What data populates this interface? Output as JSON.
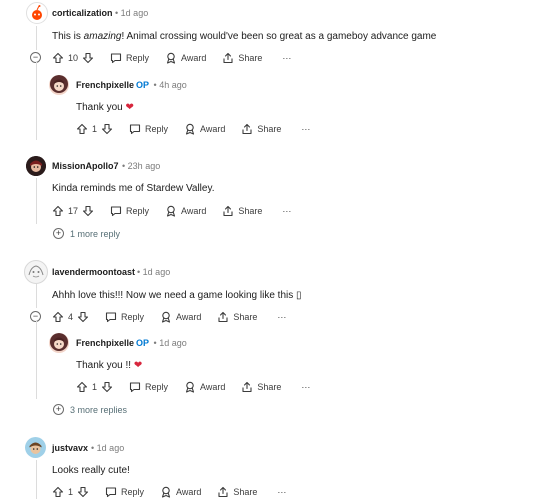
{
  "comments": [
    {
      "author": "corticalization",
      "age": "1d ago",
      "text_before": "This is ",
      "text_em": "amazing",
      "text_after": "! Animal crossing would've been so great as a gameboy advance game",
      "votes": "10",
      "reply_label": "Reply",
      "award_label": "Award",
      "share_label": "Share",
      "more_label": "···",
      "reply": {
        "author": "Frenchpixelle",
        "op_label": "OP",
        "age": "4h ago",
        "text": "Thank you",
        "votes": "1",
        "reply_label": "Reply",
        "award_label": "Award",
        "share_label": "Share",
        "more_label": "···"
      }
    },
    {
      "author": "MissionApollo7",
      "age": "23h ago",
      "text": "Kinda reminds me of Stardew Valley.",
      "votes": "17",
      "reply_label": "Reply",
      "award_label": "Award",
      "share_label": "Share",
      "more_label": "···",
      "more_replies": "1 more reply"
    },
    {
      "author": "lavendermoontoast",
      "age": "1d ago",
      "text": "Ahhh love this!!! Now we need a game looking like this ▯",
      "votes": "4",
      "reply_label": "Reply",
      "award_label": "Award",
      "share_label": "Share",
      "more_label": "···",
      "reply": {
        "author": "Frenchpixelle",
        "op_label": "OP",
        "age": "1d ago",
        "text": "Thank you !!",
        "votes": "1",
        "reply_label": "Reply",
        "award_label": "Award",
        "share_label": "Share",
        "more_label": "···"
      },
      "more_replies": "3 more replies"
    },
    {
      "author": "justvavx",
      "age": "1d ago",
      "text": "Looks really cute!",
      "votes": "1",
      "reply_label": "Reply",
      "award_label": "Award",
      "share_label": "Share",
      "more_label": "···"
    }
  ],
  "separator": "•",
  "colors": {
    "op": "#0079d3",
    "heart": "#d7263d",
    "muted": "#7c7c7c"
  }
}
